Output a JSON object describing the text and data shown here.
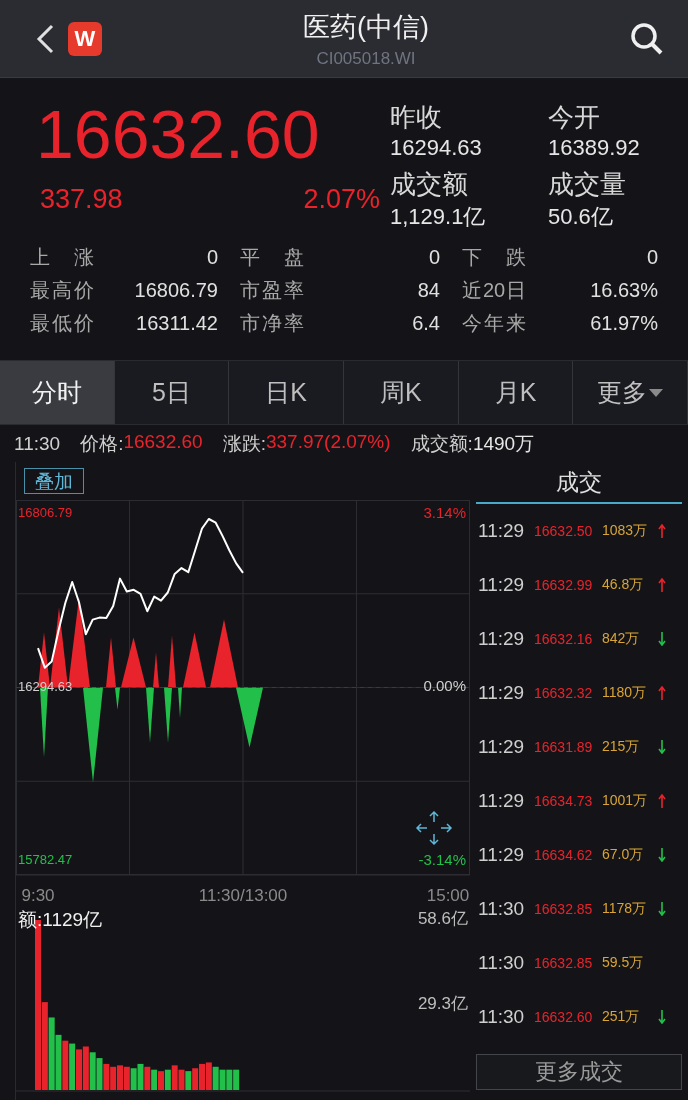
{
  "header": {
    "logo": "W",
    "title": "医药(中信)",
    "code": "CI005018.WI"
  },
  "quote": {
    "price": "16632.60",
    "change": "337.98",
    "change_pct": "2.07%",
    "side": [
      {
        "label": "昨收",
        "value": "16294.63"
      },
      {
        "label": "今开",
        "value": "16389.92"
      },
      {
        "label": "成交额",
        "value": "1,129.1亿"
      },
      {
        "label": "成交量",
        "value": "50.6亿"
      }
    ],
    "stats": [
      {
        "label": "上涨",
        "value": "0"
      },
      {
        "label": "平盘",
        "value": "0"
      },
      {
        "label": "下跌",
        "value": "0"
      },
      {
        "label": "最高价",
        "value": "16806.79"
      },
      {
        "label": "市盈率",
        "value": "84"
      },
      {
        "label": "近20日",
        "value": "16.63%"
      },
      {
        "label": "最低价",
        "value": "16311.42"
      },
      {
        "label": "市净率",
        "value": "6.4"
      },
      {
        "label": "今年来",
        "value": "61.97%"
      }
    ]
  },
  "tabs": [
    {
      "label": "分时",
      "selected": true
    },
    {
      "label": "5日",
      "selected": false
    },
    {
      "label": "日K",
      "selected": false
    },
    {
      "label": "周K",
      "selected": false
    },
    {
      "label": "月K",
      "selected": false
    },
    {
      "label": "更多",
      "selected": false,
      "dropdown": true
    }
  ],
  "info_bar": {
    "time": "11:30",
    "items": [
      {
        "label": "价格:",
        "value": "16632.60",
        "color": "#e8232b"
      },
      {
        "label": "涨跌:",
        "value": "337.97(2.07%)",
        "color": "#e8232b"
      },
      {
        "label": "成交额:",
        "value": "1490万",
        "color": "#e6e6e6"
      }
    ]
  },
  "overlay_button": "叠加",
  "price_chart": {
    "chart_data": {
      "type": "line",
      "ylim": [
        15741.14,
        16848.12
      ],
      "ref_lines": [
        {
          "axis": "y",
          "value": 16294.63
        }
      ],
      "yticks": [
        {
          "value": 16806.79,
          "label": "16806.79"
        },
        {
          "value": 16294.63,
          "label": "16294.63"
        },
        {
          "value": 15782.47,
          "label": "15782.47"
        }
      ],
      "categories": [
        "9:30",
        null,
        null,
        null,
        null,
        null,
        null,
        null,
        null,
        null,
        null,
        null,
        null,
        null,
        null,
        null,
        null,
        null,
        null,
        null,
        null,
        null,
        null,
        null,
        null,
        null,
        null,
        null,
        null,
        null,
        "11:30/13:00",
        null,
        null,
        null,
        null,
        null,
        null,
        null,
        null,
        null,
        null,
        null,
        null,
        null,
        null,
        null,
        null,
        null,
        null,
        null,
        null,
        null,
        null,
        null,
        null,
        null,
        null,
        null,
        null,
        null,
        "15:00"
      ],
      "series": [
        {
          "color": "#ffffff",
          "values": [
            16411,
            16353,
            16371,
            16462,
            16544,
            16606,
            16546,
            16452,
            16495,
            16501,
            16500,
            16535,
            16616,
            16578,
            16583,
            16571,
            16520,
            16563,
            16551,
            16575,
            16630,
            16647,
            16635,
            16700,
            16764,
            16792,
            16781,
            16742,
            16700,
            16661,
            16633,
            null,
            null,
            null,
            null,
            null,
            null,
            null,
            null,
            null,
            null,
            null,
            null,
            null,
            null,
            null,
            null,
            null,
            null,
            null,
            null,
            null,
            null,
            null,
            null,
            null,
            null,
            null,
            null,
            null,
            null
          ]
        }
      ]
    },
    "right_labels": [
      "3.14%",
      "0.00%",
      "-3.14%"
    ]
  },
  "volume_chart": {
    "label": "额:1129亿",
    "chart_data": {
      "type": "bar",
      "stacked": true,
      "ylim": [
        0,
        58.6
      ],
      "yticks": [
        {
          "value": 58.6,
          "label": "58.6亿"
        },
        {
          "value": 29.3,
          "label": "29.3亿"
        }
      ],
      "categories": [
        null,
        null,
        null,
        null,
        null,
        null,
        null,
        null,
        null,
        null,
        null,
        null,
        null,
        null,
        null,
        null,
        null,
        null,
        null,
        null,
        null,
        null,
        null,
        null,
        null,
        null,
        null,
        null,
        null,
        null,
        null,
        null,
        null,
        null,
        null,
        null,
        null,
        null,
        null,
        null,
        null,
        null,
        null,
        null,
        null,
        null,
        null,
        null,
        null,
        null,
        null,
        null,
        null,
        null,
        null,
        null,
        null,
        null,
        null,
        null,
        null
      ],
      "series": [
        {
          "color": "#e8232b",
          "values": [
            58.6,
            30.3,
            null,
            null,
            17,
            null,
            14,
            15,
            null,
            null,
            9,
            8,
            8.5,
            8,
            null,
            null,
            8,
            null,
            6.5,
            null,
            8.5,
            7,
            null,
            7.5,
            9,
            9.5,
            null,
            null,
            null,
            null,
            null,
            null,
            null,
            null,
            null,
            null,
            null,
            null,
            null,
            null,
            null,
            null,
            null,
            null,
            null,
            null,
            null,
            null,
            null,
            null,
            null,
            null,
            null,
            null,
            null,
            null,
            null,
            null,
            null,
            null,
            null
          ]
        },
        {
          "color": "#22c04a",
          "values": [
            null,
            null,
            25,
            19,
            null,
            16,
            null,
            null,
            13,
            11,
            null,
            null,
            null,
            null,
            7.5,
            9,
            null,
            7,
            null,
            7,
            null,
            null,
            6.5,
            null,
            null,
            null,
            8,
            7,
            7,
            7,
            null,
            null,
            null,
            null,
            null,
            null,
            null,
            null,
            null,
            null,
            null,
            null,
            null,
            null,
            null,
            null,
            null,
            null,
            null,
            null,
            null,
            null,
            null,
            null,
            null,
            null,
            null,
            null,
            null,
            null,
            null
          ]
        }
      ]
    }
  },
  "trades": {
    "title": "成交",
    "rows": [
      {
        "time": "11:29",
        "price": "16632.50",
        "volume": "1083万",
        "kind": "up"
      },
      {
        "time": "11:29",
        "price": "16632.99",
        "volume": "46.8万",
        "kind": "up"
      },
      {
        "time": "11:29",
        "price": "16632.16",
        "volume": "842万",
        "kind": "down"
      },
      {
        "time": "11:29",
        "price": "16632.32",
        "volume": "1180万",
        "kind": "up"
      },
      {
        "time": "11:29",
        "price": "16631.89",
        "volume": "215万",
        "kind": "down"
      },
      {
        "time": "11:29",
        "price": "16634.73",
        "volume": "1001万",
        "kind": "up"
      },
      {
        "time": "11:29",
        "price": "16634.62",
        "volume": "67.0万",
        "kind": "down"
      },
      {
        "time": "11:30",
        "price": "16632.85",
        "volume": "1178万",
        "kind": "down"
      },
      {
        "time": "11:30",
        "price": "16632.85",
        "volume": "59.5万",
        "kind": "none"
      },
      {
        "time": "11:30",
        "price": "16632.60",
        "volume": "251万",
        "kind": "down"
      }
    ],
    "more_button": "更多成交"
  }
}
